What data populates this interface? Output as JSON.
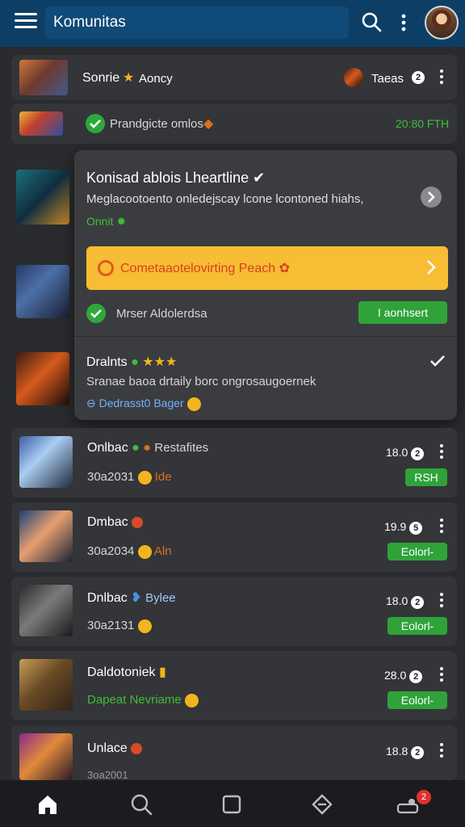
{
  "header": {
    "title": "Komunitas",
    "icons": [
      "menu-icon",
      "search-icon",
      "more-vertical-icon",
      "profile-avatar"
    ]
  },
  "feed": [
    {
      "name": "Sonrie",
      "tag": "Aoncy",
      "meta": "Taeas",
      "meta_count": "2"
    },
    {
      "name": "Prandgicte omlos",
      "time": "20:80 FTH"
    }
  ],
  "popup": {
    "title": "Konisad ablois Lheartline",
    "desc": "Meglacootoento onledejscay lcone lcontoned hiahs,",
    "status": "Onnit",
    "banner": "Cometaaotelovirting Peach",
    "check_label": "Mrser Aldolerdsa",
    "action": "I aonhsert",
    "second_title": "Dralnts",
    "second_desc": "Sranae baoa drtaily borc ongrosaugoernek",
    "second_tag": "Dedrasst0 Bager"
  },
  "list": [
    {
      "name": "Onlbac",
      "tag": "Restafites",
      "date": "30a2031",
      "date_tag": "Ide",
      "score": "18.0",
      "score_badge": "2",
      "action": "RSH"
    },
    {
      "name": "Dmbac",
      "tag": "",
      "date": "30a2034",
      "date_tag": "Aln",
      "score": "19.9",
      "score_badge": "5",
      "action": "Eolorl-"
    },
    {
      "name": "Dnlbac",
      "tag": "Bylee",
      "date": "30a2131",
      "date_tag": "",
      "score": "18.0",
      "score_badge": "2",
      "action": "Eolorl-"
    },
    {
      "name": "Daldotoniek",
      "tag": "",
      "date": "Dapeat Nevriame",
      "date_tag": "",
      "score": "28.0",
      "score_badge": "2",
      "action": "Eolorl-"
    },
    {
      "name": "Unlace",
      "tag": "",
      "date": "3oa2001",
      "date_tag": "",
      "score": "18.8",
      "score_badge": "2",
      "action": ""
    }
  ],
  "bottom_nav": {
    "items": [
      "home-icon",
      "search-icon",
      "square-icon",
      "tag-icon",
      "robot-icon"
    ],
    "notification_count": "2"
  },
  "colors": {
    "header": "#0d3f66",
    "background": "#2a2b2e",
    "card": "#343538",
    "accent_green": "#2fa33a",
    "banner": "#f7bd34"
  }
}
